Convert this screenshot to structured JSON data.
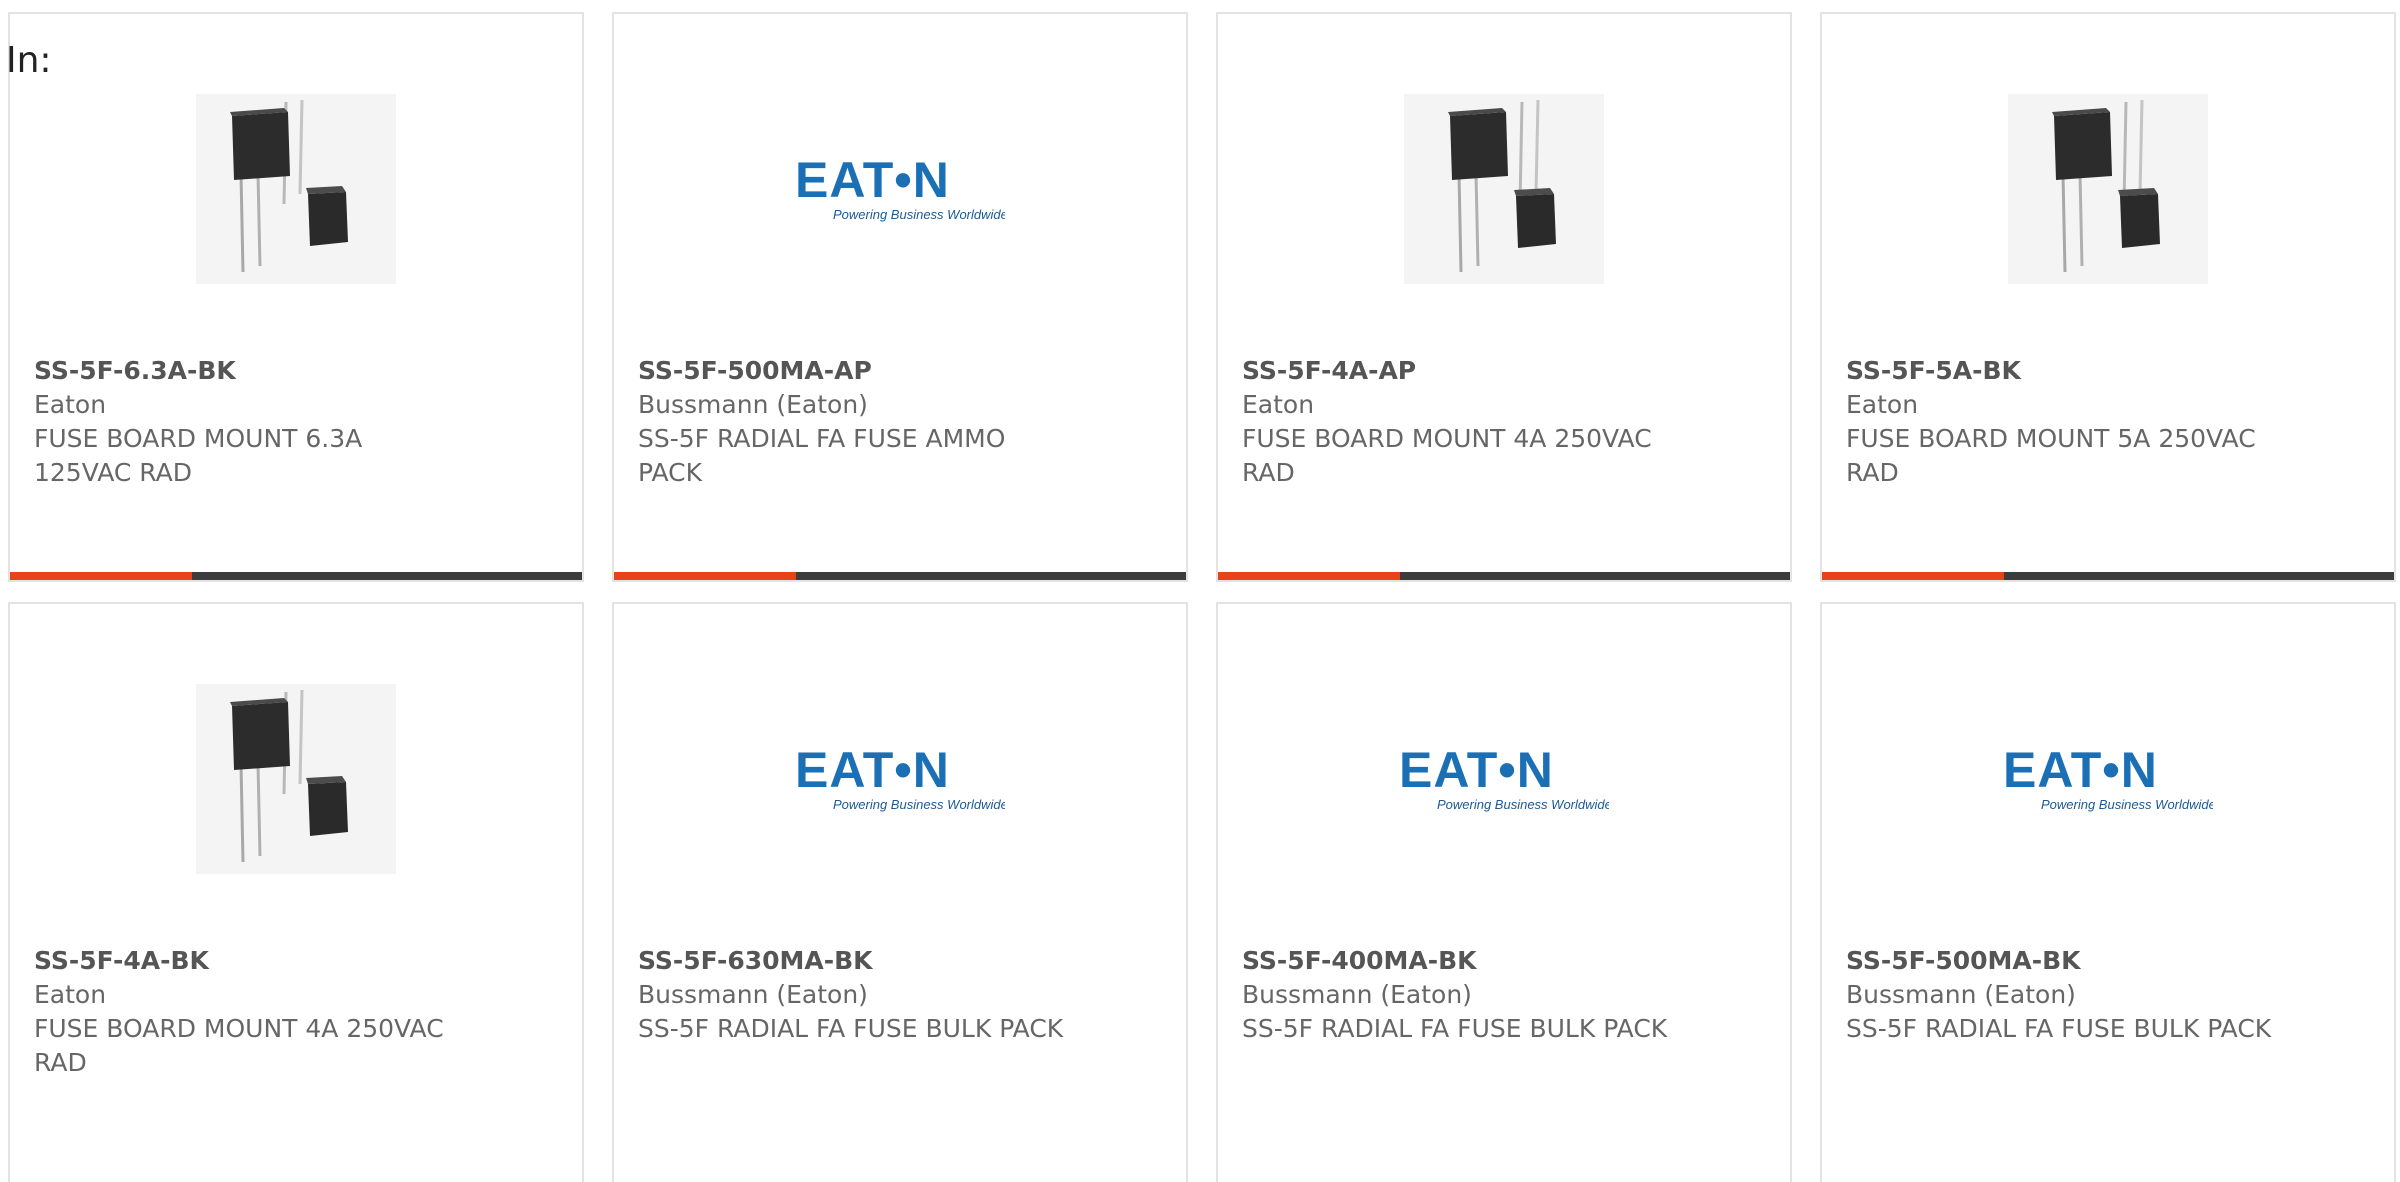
{
  "search": {
    "in_label": "In:"
  },
  "colors": {
    "accent": "#e8421b",
    "bar_dark": "#3c3c3c",
    "eaton_blue": "#1a6fb5"
  },
  "logo": {
    "eaton_text": "EAT•N",
    "tagline": "Powering Business Worldwide"
  },
  "products": [
    {
      "part_number": "SS-5F-6.3A-BK",
      "manufacturer": "Eaton",
      "description": "FUSE BOARD MOUNT 6.3A 125VAC RAD",
      "image": "fuse-photo"
    },
    {
      "part_number": "SS-5F-500MA-AP",
      "manufacturer": "Bussmann (Eaton)",
      "description": "SS-5F RADIAL FA FUSE AMMO PACK",
      "image": "eaton-logo"
    },
    {
      "part_number": "SS-5F-4A-AP",
      "manufacturer": "Eaton",
      "description": "FUSE BOARD MOUNT 4A 250VAC RAD",
      "image": "fuse-photo"
    },
    {
      "part_number": "SS-5F-5A-BK",
      "manufacturer": "Eaton",
      "description": "FUSE BOARD MOUNT 5A 250VAC RAD",
      "image": "fuse-photo"
    },
    {
      "part_number": "SS-5F-4A-BK",
      "manufacturer": "Eaton",
      "description": "FUSE BOARD MOUNT 4A 250VAC RAD",
      "image": "fuse-photo"
    },
    {
      "part_number": "SS-5F-630MA-BK",
      "manufacturer": "Bussmann (Eaton)",
      "description": "SS-5F RADIAL FA FUSE BULK PACK",
      "image": "eaton-logo"
    },
    {
      "part_number": "SS-5F-400MA-BK",
      "manufacturer": "Bussmann (Eaton)",
      "description": "SS-5F RADIAL FA FUSE BULK PACK",
      "image": "eaton-logo"
    },
    {
      "part_number": "SS-5F-500MA-BK",
      "manufacturer": "Bussmann (Eaton)",
      "description": "SS-5F RADIAL FA FUSE BULK PACK",
      "image": "eaton-logo"
    }
  ]
}
